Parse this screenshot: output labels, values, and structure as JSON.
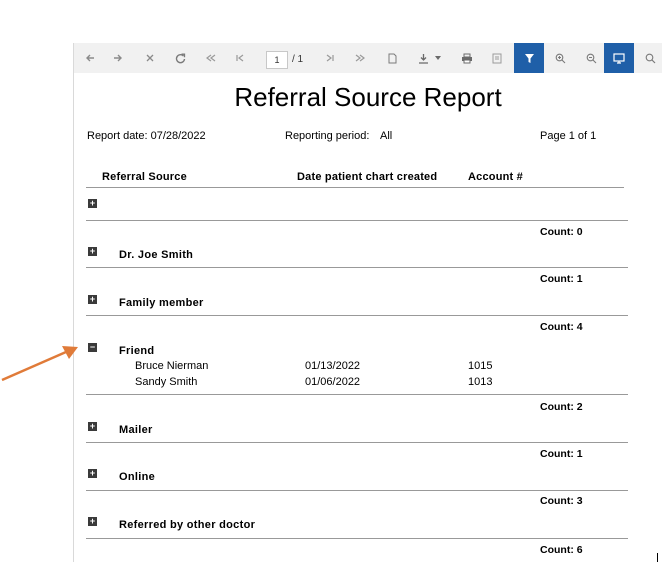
{
  "toolbar": {
    "page_input": "1",
    "page_total": "/ 1",
    "buttons": [
      "back-icon",
      "forward-icon",
      "close-icon",
      "refresh-icon",
      "first-page-icon",
      "previous-page-icon",
      "next-page-icon",
      "last-page-icon",
      "document-icon",
      "download-icon",
      "print-icon",
      "print-page-icon",
      "filter-icon",
      "zoom-in-icon",
      "zoom-out-icon",
      "display-icon",
      "search-icon"
    ],
    "accent": "#1f5fa8"
  },
  "report": {
    "title": "Referral Source Report",
    "report_date": "Report date: 07/28/2022",
    "period_label": "Reporting period:",
    "period_value": "All",
    "page_info": "Page 1 of 1",
    "columns": [
      "Referral Source",
      "Date patient chart created",
      "Account #"
    ],
    "groups": [
      {
        "label": "",
        "count": "Count: 0",
        "expanded": false,
        "rows": []
      },
      {
        "label": "Dr. Joe Smith",
        "count": "Count: 1",
        "expanded": false,
        "rows": []
      },
      {
        "label": "Family member",
        "count": "Count: 4",
        "expanded": false,
        "rows": []
      },
      {
        "label": "Friend",
        "count": "Count: 2",
        "expanded": true,
        "rows": [
          {
            "name": "Bruce Nierman",
            "date": "01/13/2022",
            "account": "1015"
          },
          {
            "name": "Sandy Smith",
            "date": "01/06/2022",
            "account": "1013"
          }
        ]
      },
      {
        "label": "Mailer",
        "count": "Count: 1",
        "expanded": false,
        "rows": []
      },
      {
        "label": "Online",
        "count": "Count: 3",
        "expanded": false,
        "rows": []
      },
      {
        "label": "Referred by other doctor",
        "count": "Count: 6",
        "expanded": false,
        "rows": []
      }
    ]
  },
  "annotation": {
    "arrow_color": "#e07b39"
  }
}
